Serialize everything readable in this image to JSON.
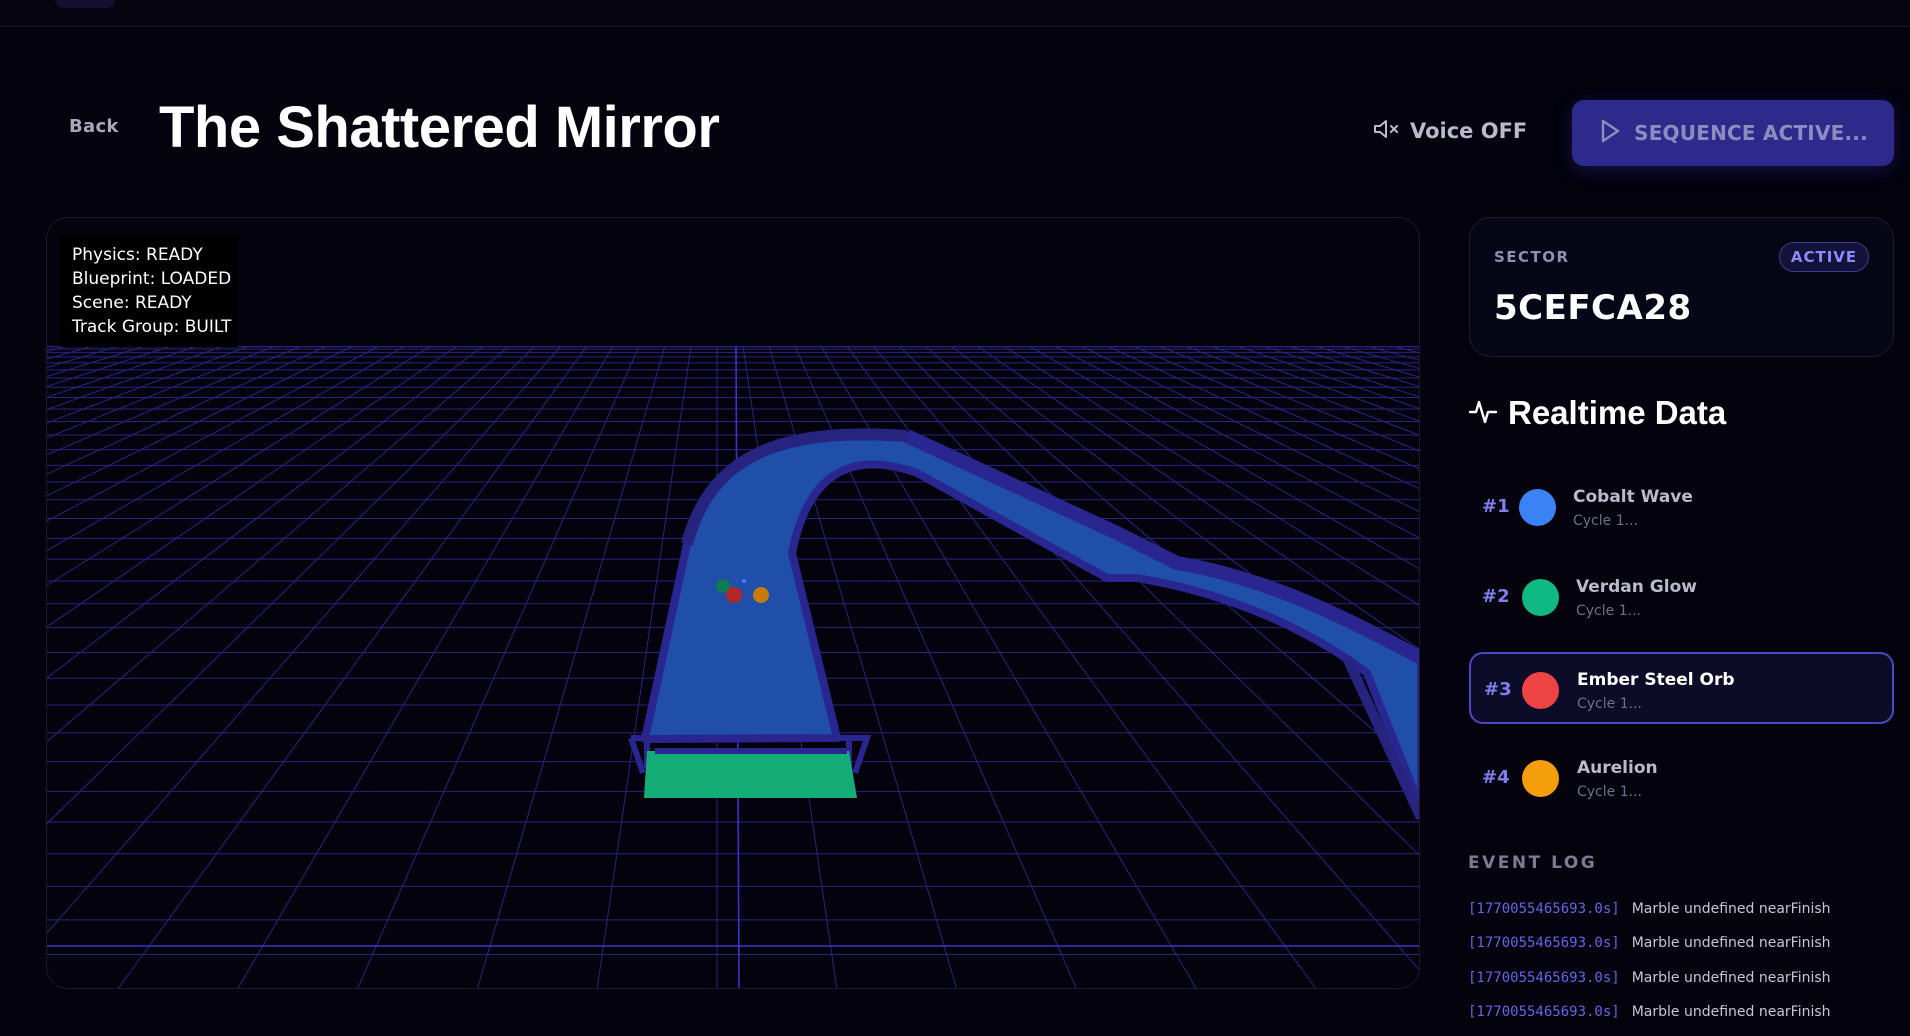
{
  "header": {
    "back_label": "Back",
    "title": "The Shattered Mirror",
    "voice_label": "Voice OFF",
    "voice_icon": "speaker-muted-icon",
    "sequence_label": "SEQUENCE ACTIVE...",
    "sequence_icon": "play-icon"
  },
  "viewport": {
    "status_lines": [
      "Physics: READY",
      "Blueprint: LOADED",
      "Scene: READY",
      "Track Group: BUILT"
    ],
    "grid_color": "#2a2580",
    "track_color": "#1f4fa8",
    "finish_color": "#14ad78"
  },
  "sector": {
    "label": "SECTOR",
    "badge": "ACTIVE",
    "code": "5CEFCA28"
  },
  "realtime": {
    "title": "Realtime Data",
    "icon": "pulse-icon",
    "racers": [
      {
        "rank": "#1",
        "name": "Cobalt Wave",
        "status": "Cycle 1...",
        "color": "#3b82f6"
      },
      {
        "rank": "#2",
        "name": "Verdan Glow",
        "status": "Cycle 1...",
        "color": "#10b981"
      },
      {
        "rank": "#3",
        "name": "Ember Steel Orb",
        "status": "Cycle 1...",
        "color": "#ef4444"
      },
      {
        "rank": "#4",
        "name": "Aurelion",
        "status": "Cycle 1...",
        "color": "#f59e0b"
      }
    ]
  },
  "event_log": {
    "title": "EVENT LOG",
    "entries": [
      {
        "ts": "[1770055465693.0s]",
        "msg": "Marble undefined nearFinish"
      },
      {
        "ts": "[1770055465693.0s]",
        "msg": "Marble undefined nearFinish"
      },
      {
        "ts": "[1770055465693.0s]",
        "msg": "Marble undefined nearFinish"
      },
      {
        "ts": "[1770055465693.0s]",
        "msg": "Marble undefined nearFinish"
      }
    ]
  }
}
